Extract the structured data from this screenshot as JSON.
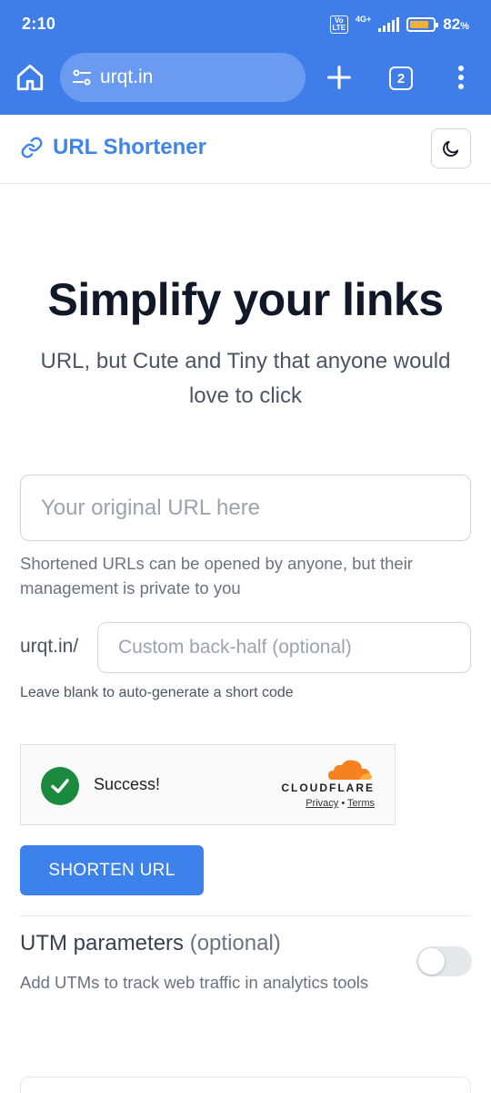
{
  "status_bar": {
    "time": "2:10",
    "volte": "Vo LTE",
    "network": "4G+",
    "battery_percent": "82",
    "battery_unit": "%",
    "battery_level": 0.82
  },
  "browser": {
    "address": "urqt.in",
    "tab_count": "2",
    "accent_color": "#3f7ee8"
  },
  "header": {
    "brand": "URL Shortener",
    "brand_icon": "link-icon",
    "theme_icon": "moon-icon"
  },
  "hero": {
    "title": "Simplify your links",
    "subtitle": "URL, but Cute and Tiny that anyone would love to click"
  },
  "form": {
    "url_placeholder": "Your original URL here",
    "privacy_note": "Shortened URLs can be opened by anyone, but their management is private to you",
    "prefix": "urqt.in/",
    "alias_placeholder": "Custom back-half (optional)",
    "alias_hint": "Leave blank to auto-generate a short code",
    "submit_label": "SHORTEN URL"
  },
  "captcha": {
    "status": "Success!",
    "provider": "CLOUDFLARE",
    "privacy_link": "Privacy",
    "separator": "•",
    "terms_link": "Terms"
  },
  "utm": {
    "title": "UTM parameters",
    "optional": "(optional)",
    "description": "Add UTMs to track web traffic in analytics tools",
    "enabled": false
  }
}
